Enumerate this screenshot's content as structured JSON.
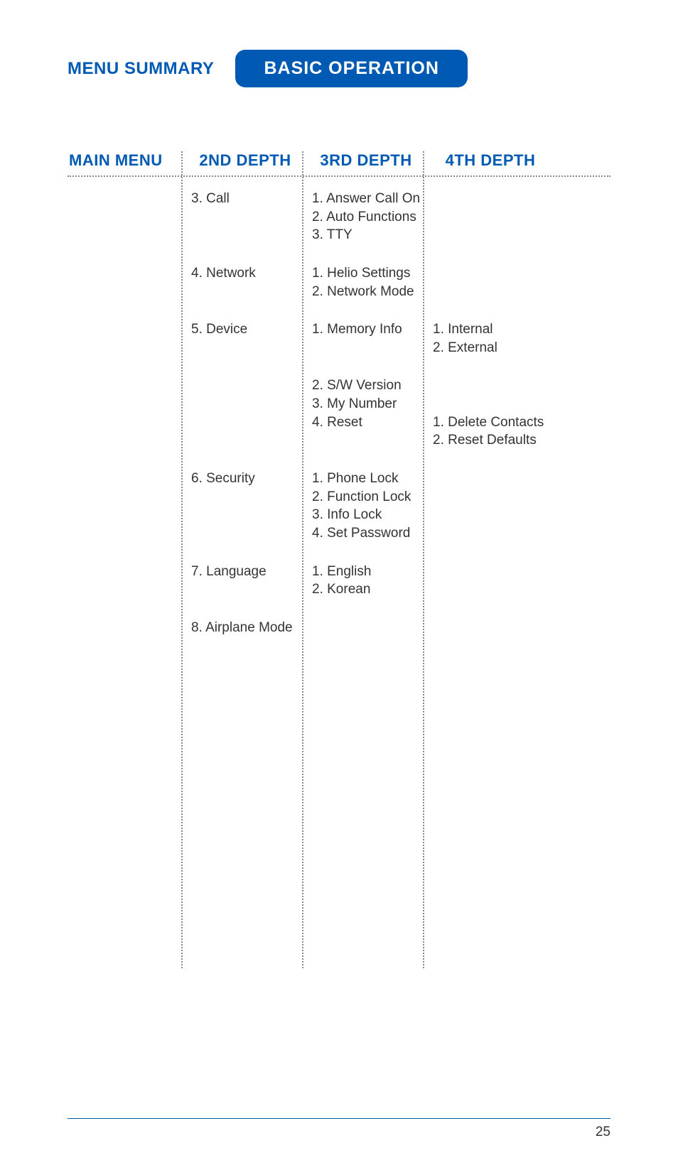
{
  "header": {
    "menu_summary": "MENU SUMMARY",
    "basic_operation": "BASIC OPERATION"
  },
  "columns": {
    "col1": "MAIN MENU",
    "col2": "2ND DEPTH",
    "col3": "3RD DEPTH",
    "col4": "4TH DEPTH"
  },
  "rows": [
    {
      "depth2": "3. Call",
      "depth3": "1. Answer Call On\n2. Auto Functions\n3. TTY",
      "depth4": ""
    },
    {
      "depth2": "4. Network",
      "depth3": "1. Helio Settings\n2. Network Mode",
      "depth4": ""
    },
    {
      "depth2": "5. Device",
      "depth3": "1. Memory Info",
      "depth4": "1. Internal\n2. External"
    },
    {
      "depth2": "",
      "depth3": "2. S/W Version\n3. My Number\n4. Reset",
      "depth4": "\n\n1. Delete Contacts\n2. Reset Defaults"
    },
    {
      "depth2": "6. Security",
      "depth3": "1. Phone Lock\n2. Function Lock\n3. Info Lock\n4. Set Password",
      "depth4": ""
    },
    {
      "depth2": "7. Language",
      "depth3": "1. English\n2. Korean",
      "depth4": ""
    },
    {
      "depth2": "8. Airplane Mode",
      "depth3": "",
      "depth4": ""
    }
  ],
  "footer": {
    "page_number": "25"
  }
}
